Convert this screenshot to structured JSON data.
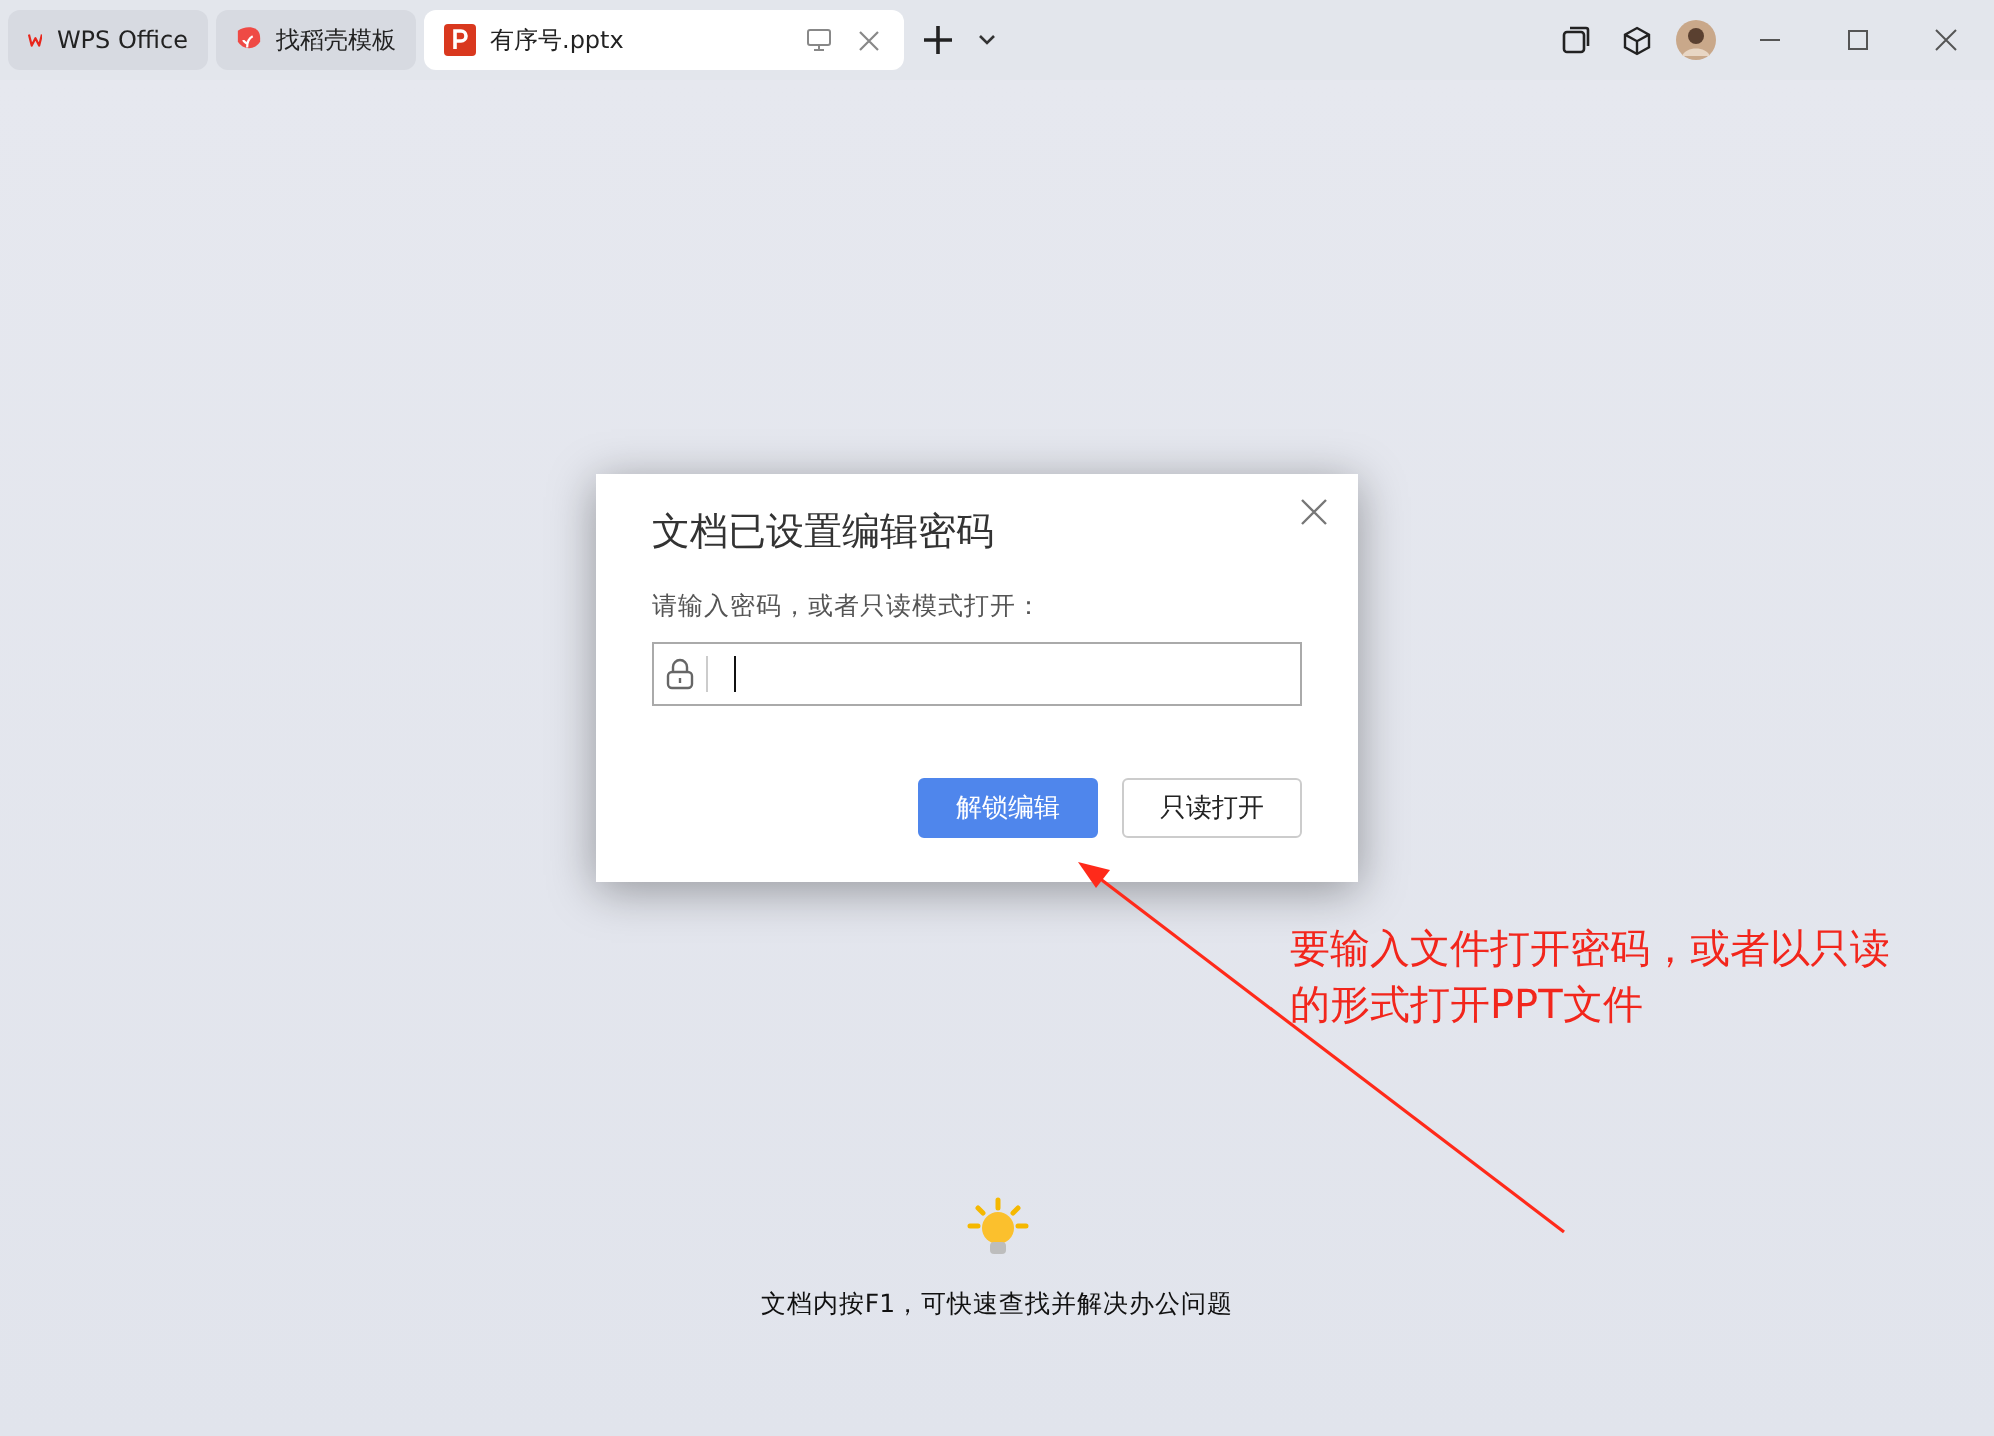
{
  "tabs": [
    {
      "kind": "wps",
      "label": "WPS Office",
      "selected": false,
      "closable": false
    },
    {
      "kind": "template",
      "label": "找稻壳模板",
      "selected": false,
      "closable": false
    },
    {
      "kind": "ppt",
      "label": "有序号.pptx",
      "selected": true,
      "closable": true
    }
  ],
  "dialog": {
    "title": "文档已设置编辑密码",
    "prompt": "请输入密码，或者只读模式打开：",
    "buttons": [
      {
        "label": "解锁编辑",
        "primary": true
      },
      {
        "label": "只读打开",
        "primary": false
      }
    ]
  },
  "annotation": {
    "text": "要输入文件打开密码，或者以只读的形式打开PPT文件"
  },
  "tip": {
    "text": "文档内按F1，可快速查找并解决办公问题"
  }
}
